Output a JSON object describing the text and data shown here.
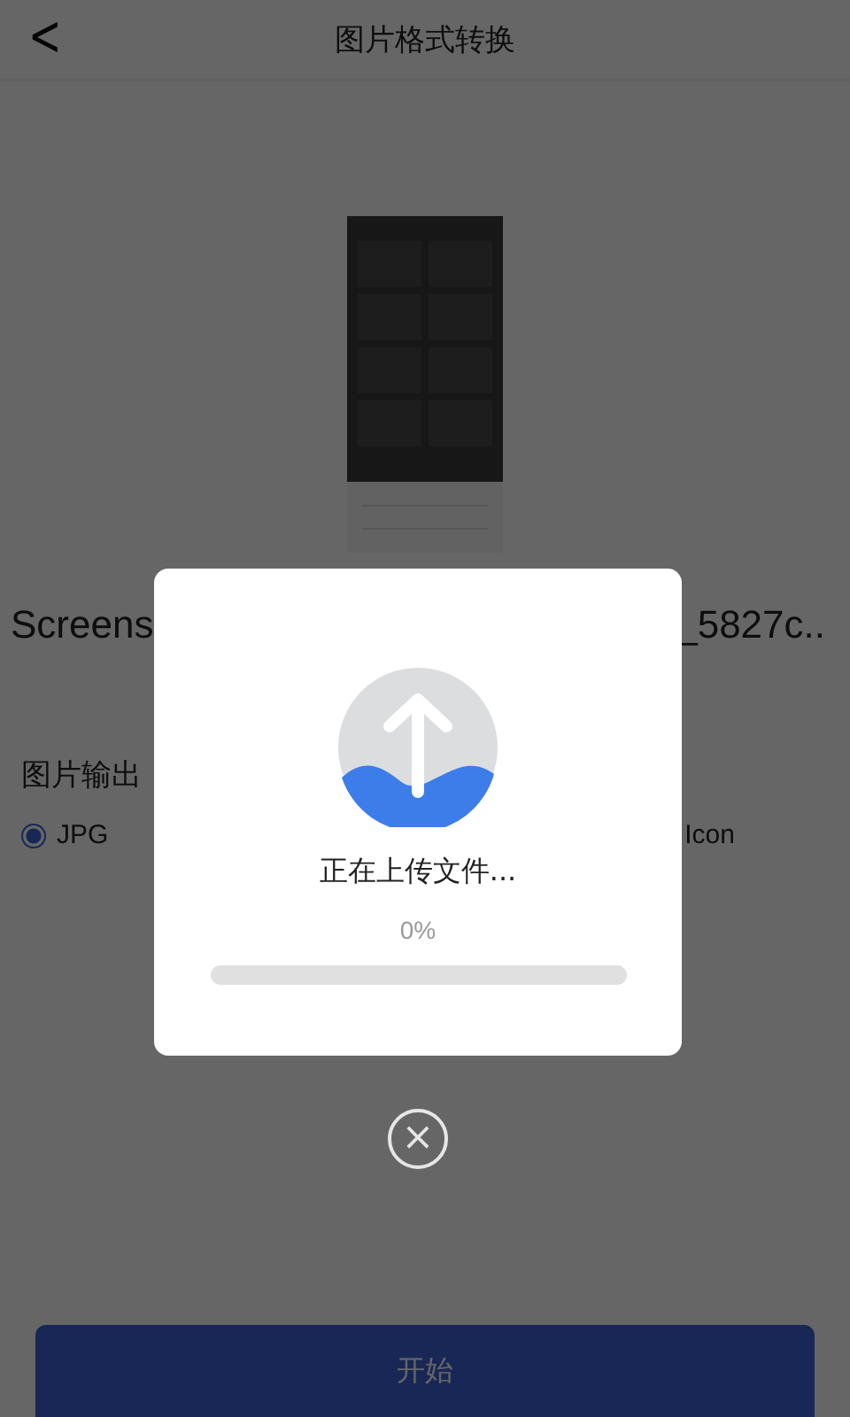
{
  "header": {
    "back": "<",
    "title": "图片格式转换"
  },
  "file_name": {
    "start": "Screens",
    "end": "_5827c.."
  },
  "output": {
    "label": "图片输出",
    "options": [
      {
        "kind": "radio",
        "label": "JPG",
        "selected": true
      },
      {
        "kind": "text",
        "label": "Icon"
      }
    ]
  },
  "start_button": "开始",
  "upload_dialog": {
    "message": "正在上传文件...",
    "percent": "0%",
    "level": 0
  },
  "cancel": "×"
}
